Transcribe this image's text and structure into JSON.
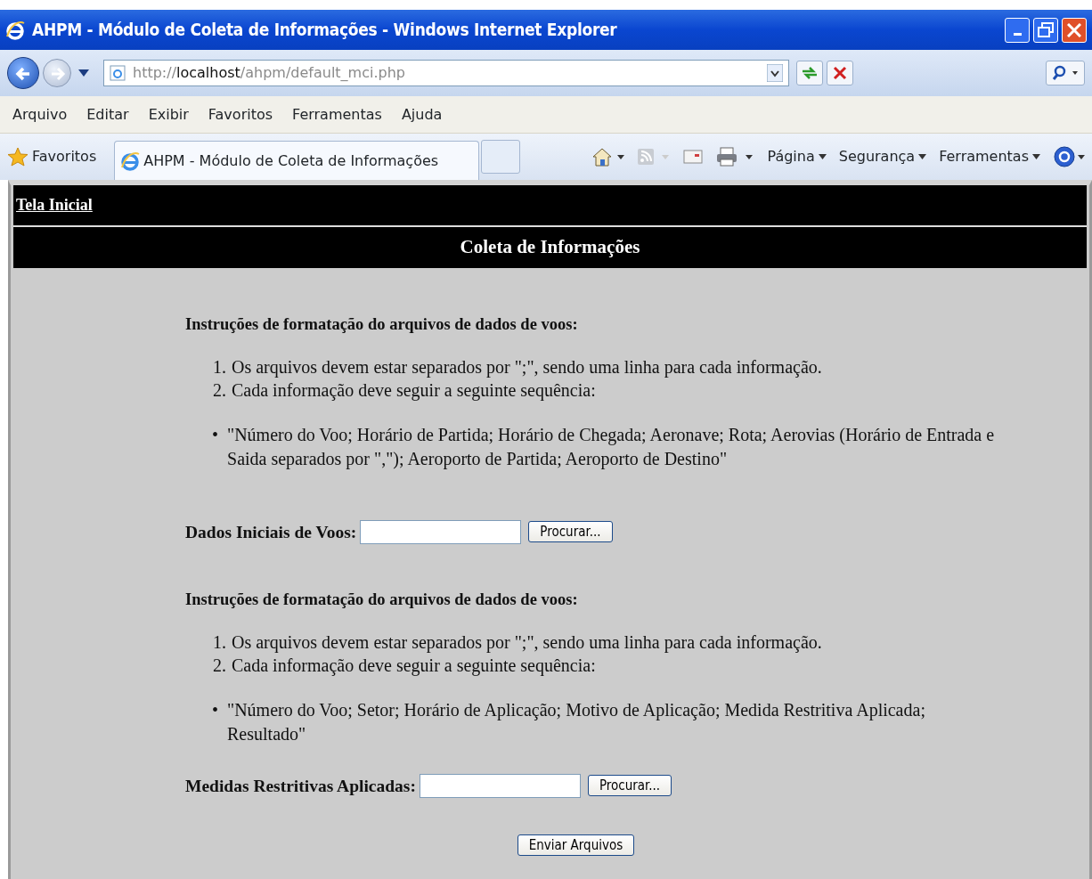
{
  "window": {
    "title": "AHPM - Módulo de Coleta de Informações - Windows Internet Explorer"
  },
  "address_bar": {
    "scheme": "http://",
    "host": "localhost",
    "path": "/ahpm/default_mci.php"
  },
  "menu_bar": [
    "Arquivo",
    "Editar",
    "Exibir",
    "Favoritos",
    "Ferramentas",
    "Ajuda"
  ],
  "favorites_bar": {
    "favorites": "Favoritos",
    "tab": "AHPM - Módulo de Coleta de Informações",
    "commands": [
      "Página",
      "Segurança",
      "Ferramentas"
    ]
  },
  "page": {
    "home_link": "Tela Inicial",
    "heading": "Coleta de Informações",
    "sections": [
      {
        "instructions_title": "Instruções de formatação do arquivos de dados de voos:",
        "steps": [
          {
            "number": "1.",
            "text": "Os arquivos devem estar separados por \";\", sendo uma linha para cada informação."
          },
          {
            "number": "2.",
            "text": "Cada informação deve seguir a seguinte sequência:"
          }
        ],
        "marker": "•",
        "format": "\"Número do Voo; Horário de Partida; Horário de Chegada; Aeronave; Rota; Aerovias (Horário de Entrada e Saida separados por \",\"); Aeroporto de Partida; Aeroporto de Destino\"",
        "field_label": "Dados Iniciais de Voos:",
        "browse_button": "Procurar..."
      },
      {
        "instructions_title": "Instruções de formatação do arquivos de dados de voos:",
        "steps": [
          {
            "number": "1.",
            "text": "Os arquivos devem estar separados por \";\", sendo uma linha para cada informação."
          },
          {
            "number": "2.",
            "text": "Cada informação deve seguir a seguinte sequência:"
          }
        ],
        "marker": "•",
        "format": "\"Número do Voo; Setor; Horário de Aplicação; Motivo de Aplicação; Medida Restritiva Aplicada; Resultado\"",
        "field_label": "Medidas Restritivas Aplicadas:",
        "browse_button": "Procurar..."
      }
    ],
    "submit_button": "Enviar Arquivos"
  }
}
